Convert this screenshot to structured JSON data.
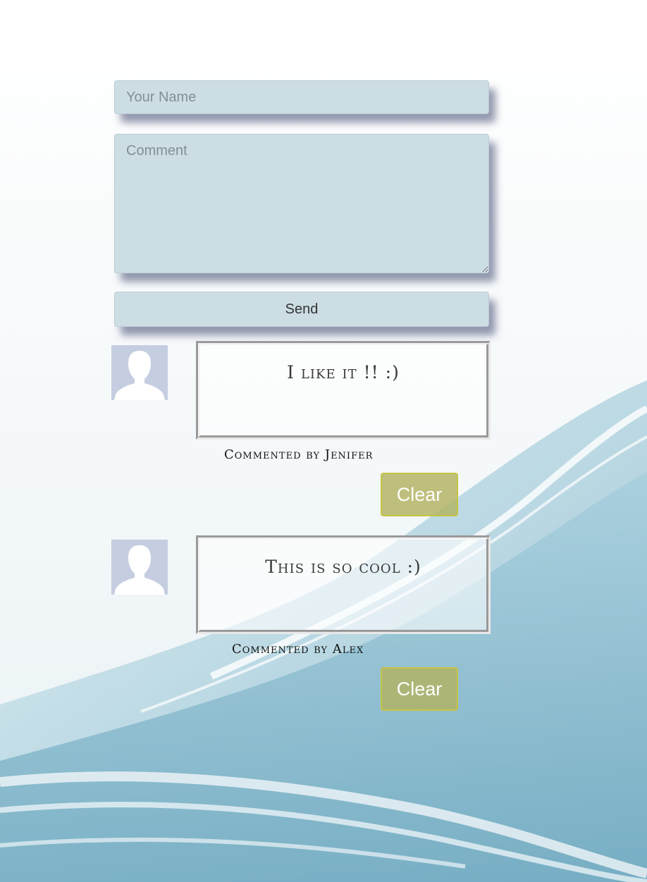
{
  "form": {
    "name_placeholder": "Your Name",
    "comment_placeholder": "Comment",
    "send_label": "Send"
  },
  "comments": [
    {
      "avatar_icon": "user-silhouette-icon",
      "text": "I like it !! :)",
      "byline": "Commented by Jenifer",
      "clear_label": "Clear"
    },
    {
      "avatar_icon": "user-silhouette-icon",
      "text": "This is so cool :)",
      "byline": "Commented by Alex",
      "clear_label": "Clear"
    }
  ],
  "colors": {
    "input_bg": "#ccdde4",
    "clear_button_bg": "#b2b260",
    "avatar_bg": "#c5cde0",
    "background_accent": "#6fa8c0"
  }
}
